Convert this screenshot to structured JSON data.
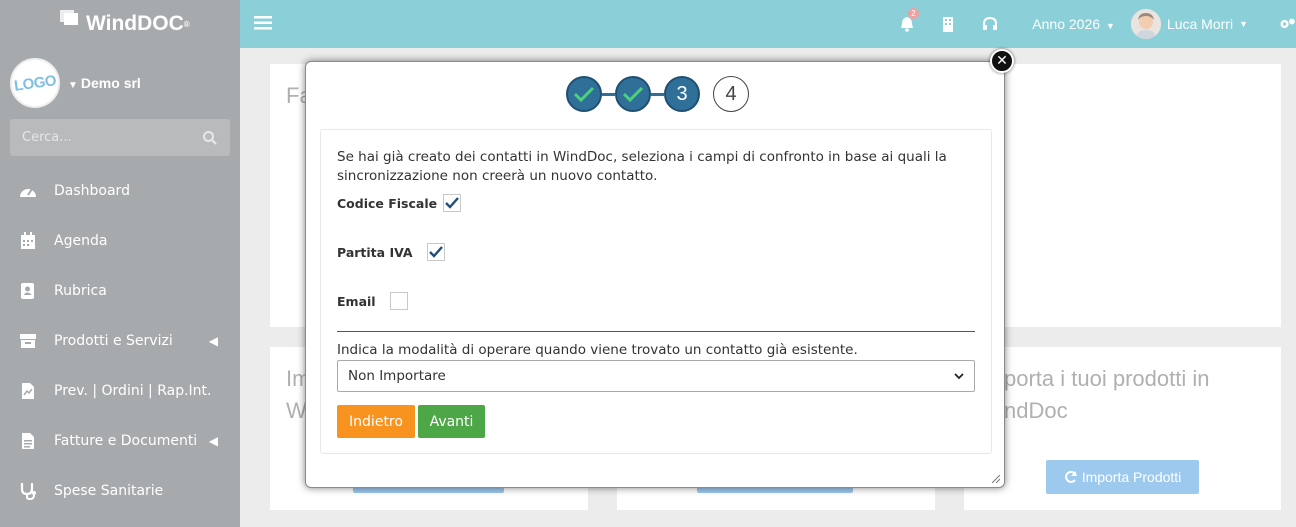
{
  "app": {
    "brand": "WindDOC",
    "brand_mark": "®"
  },
  "sidebar": {
    "company_logo_text": "LOGO",
    "company_name": "Demo srl",
    "search_placeholder": "Cerca...",
    "items": [
      {
        "label": "Dashboard",
        "icon": "dashboard-icon"
      },
      {
        "label": "Agenda",
        "icon": "calendar-icon"
      },
      {
        "label": "Rubrica",
        "icon": "address-book-icon"
      },
      {
        "label": "Prodotti e Servizi",
        "icon": "box-icon",
        "has_submenu": true
      },
      {
        "label": "Prev. | Ordini | Rap.Int.",
        "icon": "document-chart-icon"
      },
      {
        "label": "Fatture e Documenti",
        "icon": "document-icon",
        "has_submenu": true
      },
      {
        "label": "Spese Sanitarie",
        "icon": "stethoscope-icon"
      }
    ]
  },
  "topbar": {
    "notifications_count": "2",
    "year_label": "Anno 2026",
    "user_name": "Luca Morri"
  },
  "background": {
    "card1_title_fragment": "Fa",
    "card2_title_fragment_line1": "Im",
    "card2_title_fragment_line2": "W",
    "card4_title_line1": "porta i tuoi prodotti in",
    "card4_title_line2": "ndDoc",
    "import_products_button": "Importa Prodotti"
  },
  "modal": {
    "steps": [
      {
        "label": "",
        "state": "done"
      },
      {
        "label": "",
        "state": "done"
      },
      {
        "label": "3",
        "state": "active"
      },
      {
        "label": "4",
        "state": "todo"
      }
    ],
    "intro_text": "Se hai già creato dei contatti in WindDoc, seleziona i campi di confronto in base ai quali la sincronizzazione non creerà un nuovo contatto.",
    "fields": [
      {
        "label": "Codice Fiscale",
        "checked": true
      },
      {
        "label": "Partita IVA",
        "checked": true
      },
      {
        "label": "Email",
        "checked": false
      }
    ],
    "mode_label": "Indica la modalità di operare quando viene trovato un contatto già esistente.",
    "mode_selected": "Non Importare",
    "back_button": "Indietro",
    "next_button": "Avanti"
  },
  "colors": {
    "topbar": "#8bd0d9",
    "sidebar": "#a7aaac",
    "step_active": "#2f6f98",
    "back_button": "#f7931e",
    "next_button": "#4ea747"
  }
}
